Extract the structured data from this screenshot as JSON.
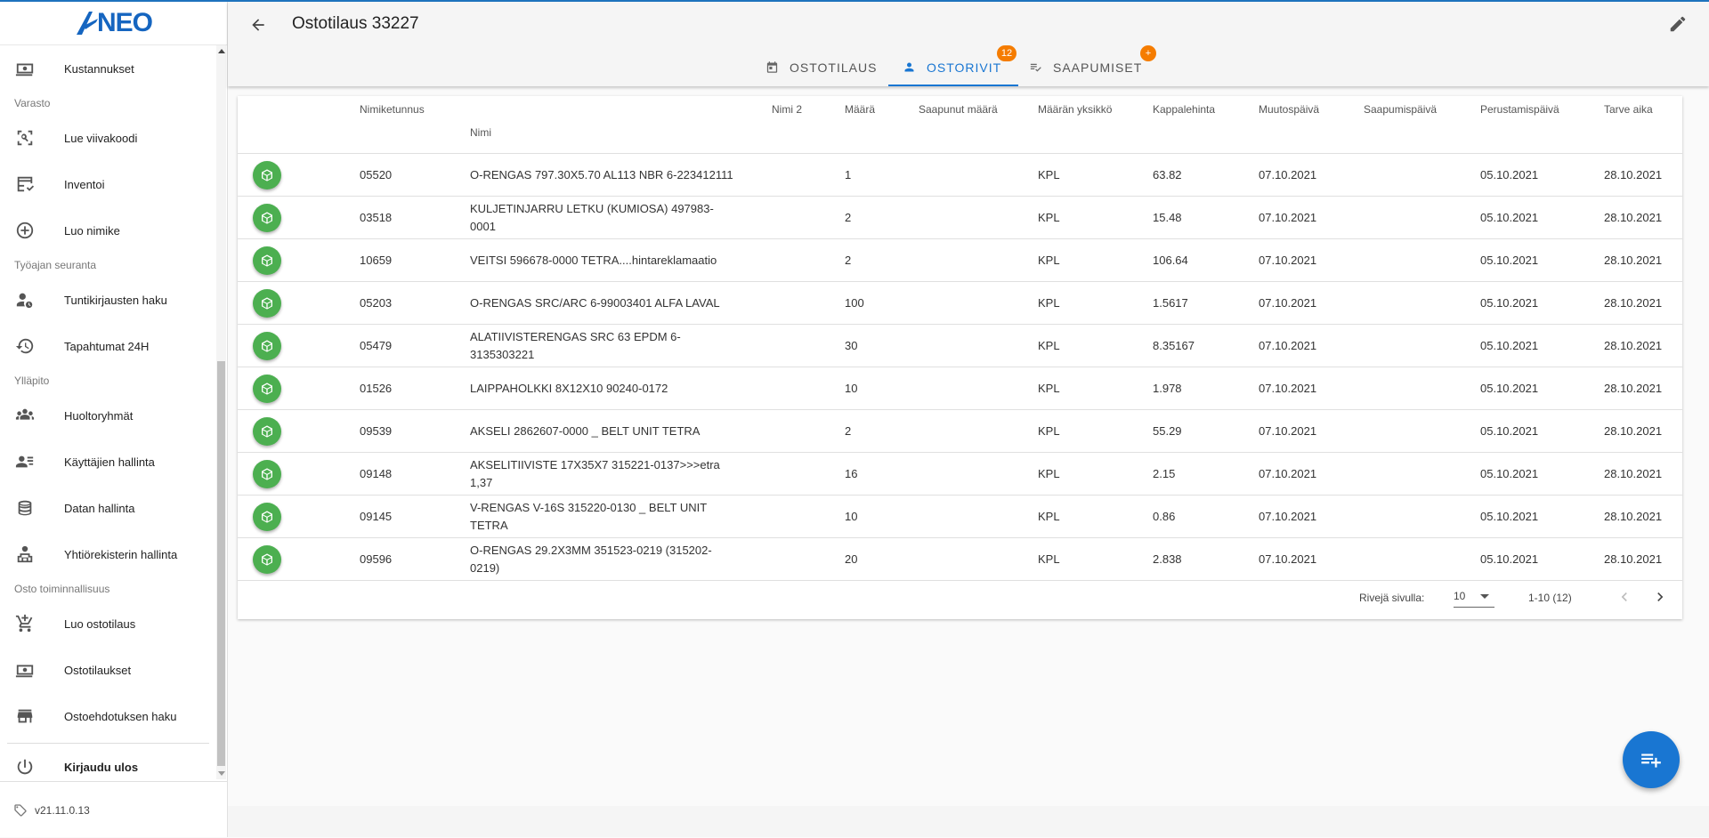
{
  "app": {
    "logo_text": "NEO"
  },
  "sidebar": {
    "items": [
      {
        "type": "item",
        "label": "Kustannukset",
        "icon": "money-icon"
      },
      {
        "type": "section",
        "label": "Varasto"
      },
      {
        "type": "item",
        "label": "Lue viivakoodi",
        "icon": "barcode-scan-icon"
      },
      {
        "type": "item",
        "label": "Inventoi",
        "icon": "table-check-icon"
      },
      {
        "type": "item",
        "label": "Luo nimike",
        "icon": "add-circle-icon"
      },
      {
        "type": "section",
        "label": "Työajan seuranta"
      },
      {
        "type": "item",
        "label": "Tuntikirjausten haku",
        "icon": "user-clock-icon"
      },
      {
        "type": "item",
        "label": "Tapahtumat 24H",
        "icon": "history-icon"
      },
      {
        "type": "section",
        "label": "Ylläpito"
      },
      {
        "type": "item",
        "label": "Huoltoryhmät",
        "icon": "group-icon"
      },
      {
        "type": "item",
        "label": "Käyttäjien hallinta",
        "icon": "users-list-icon"
      },
      {
        "type": "item",
        "label": "Datan hallinta",
        "icon": "database-icon"
      },
      {
        "type": "item",
        "label": "Yhtiörekisterin hallinta",
        "icon": "company-icon"
      },
      {
        "type": "section",
        "label": "Osto toiminnallisuus"
      },
      {
        "type": "item",
        "label": "Luo ostotilaus",
        "icon": "cart-add-icon"
      },
      {
        "type": "item",
        "label": "Ostotilaukset",
        "icon": "money-icon"
      },
      {
        "type": "item",
        "label": "Ostoehdotuksen haku",
        "icon": "store-icon"
      },
      {
        "type": "divider"
      },
      {
        "type": "item",
        "label": "Kirjaudu ulos",
        "icon": "power-icon"
      }
    ],
    "version": "v21.11.0.13"
  },
  "header": {
    "title": "Ostotilaus 33227"
  },
  "tabs": [
    {
      "label": "OSTOTILAUS",
      "icon": "calendar-icon",
      "active": false
    },
    {
      "label": "OSTORIVIT",
      "icon": "person-icon",
      "active": true,
      "badge": "12"
    },
    {
      "label": "SAAPUMISET",
      "icon": "playlist-icon",
      "active": false,
      "badge": "+"
    }
  ],
  "table": {
    "headers": {
      "nimiketunnus": "Nimiketunnus",
      "nimi": "Nimi",
      "nimi2": "Nimi 2",
      "maara": "Määrä",
      "saapunut": "Saapunut määrä",
      "yksikko": "Määrän yksikkö",
      "hinta": "Kappalehinta",
      "muutospaiva": "Muutospäivä",
      "saapumispaiva": "Saapumispäivä",
      "perustamispaiva": "Perustamispäivä",
      "tarve": "Tarve aika"
    },
    "rows": [
      {
        "code": "05520",
        "name": "O-RENGAS 797.30X5.70 AL113 NBR 6-223412111",
        "name2": "",
        "qty": "1",
        "arrived": "",
        "unit": "KPL",
        "price": "63.82",
        "modified": "07.10.2021",
        "arrival": "",
        "created": "05.10.2021",
        "need": "28.10.2021"
      },
      {
        "code": "03518",
        "name": "KULJETINJARRU LETKU (KUMIOSA) 497983-0001",
        "name2": "",
        "qty": "2",
        "arrived": "",
        "unit": "KPL",
        "price": "15.48",
        "modified": "07.10.2021",
        "arrival": "",
        "created": "05.10.2021",
        "need": "28.10.2021"
      },
      {
        "code": "10659",
        "name": "VEITSI 596678-0000 TETRA....hintareklamaatio",
        "name2": "",
        "qty": "2",
        "arrived": "",
        "unit": "KPL",
        "price": "106.64",
        "modified": "07.10.2021",
        "arrival": "",
        "created": "05.10.2021",
        "need": "28.10.2021"
      },
      {
        "code": "05203",
        "name": "O-RENGAS SRC/ARC 6-99003401 ALFA LAVAL",
        "name2": "",
        "qty": "100",
        "arrived": "",
        "unit": "KPL",
        "price": "1.5617",
        "modified": "07.10.2021",
        "arrival": "",
        "created": "05.10.2021",
        "need": "28.10.2021"
      },
      {
        "code": "05479",
        "name": "ALATIIVISTERENGAS SRC 63 EPDM 6-3135303221",
        "name2": "",
        "qty": "30",
        "arrived": "",
        "unit": "KPL",
        "price": "8.35167",
        "modified": "07.10.2021",
        "arrival": "",
        "created": "05.10.2021",
        "need": "28.10.2021"
      },
      {
        "code": "01526",
        "name": "LAIPPAHOLKKI 8X12X10 90240-0172",
        "name2": "",
        "qty": "10",
        "arrived": "",
        "unit": "KPL",
        "price": "1.978",
        "modified": "07.10.2021",
        "arrival": "",
        "created": "05.10.2021",
        "need": "28.10.2021"
      },
      {
        "code": "09539",
        "name": "AKSELI 2862607-0000 _ BELT UNIT TETRA",
        "name2": "",
        "qty": "2",
        "arrived": "",
        "unit": "KPL",
        "price": "55.29",
        "modified": "07.10.2021",
        "arrival": "",
        "created": "05.10.2021",
        "need": "28.10.2021"
      },
      {
        "code": "09148",
        "name": "AKSELITIIVISTE 17X35X7 315221-0137>>>etra 1,37",
        "name2": "",
        "qty": "16",
        "arrived": "",
        "unit": "KPL",
        "price": "2.15",
        "modified": "07.10.2021",
        "arrival": "",
        "created": "05.10.2021",
        "need": "28.10.2021"
      },
      {
        "code": "09145",
        "name": "V-RENGAS V-16S 315220-0130 _ BELT UNIT TETRA",
        "name2": "",
        "qty": "10",
        "arrived": "",
        "unit": "KPL",
        "price": "0.86",
        "modified": "07.10.2021",
        "arrival": "",
        "created": "05.10.2021",
        "need": "28.10.2021"
      },
      {
        "code": "09596",
        "name": "O-RENGAS 29.2X3MM 351523-0219 (315202-0219)",
        "name2": "",
        "qty": "20",
        "arrived": "",
        "unit": "KPL",
        "price": "2.838",
        "modified": "07.10.2021",
        "arrival": "",
        "created": "05.10.2021",
        "need": "28.10.2021"
      }
    ]
  },
  "pagination": {
    "rows_label": "Rivejä sivulla:",
    "rows_value": "10",
    "range": "1-10 (12)"
  },
  "colors": {
    "primary": "#1976d2",
    "row_button": "#4caf50",
    "badge": "#f57c00"
  }
}
